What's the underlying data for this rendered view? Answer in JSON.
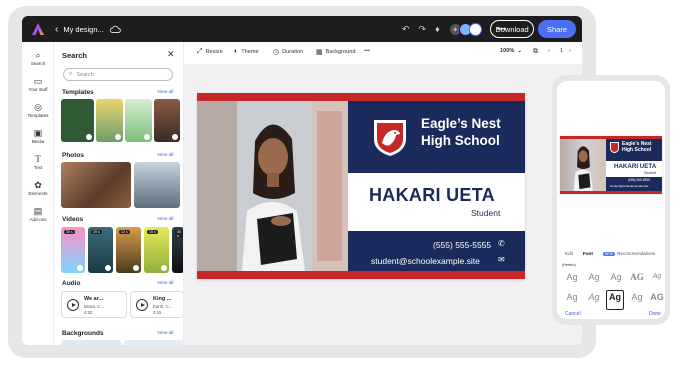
{
  "topbar": {
    "doc_title": "My design...",
    "download_label": "Download",
    "share_label": "Share",
    "accent": "#4b6ef5"
  },
  "rail": [
    {
      "icon": "search-icon",
      "label": "Search"
    },
    {
      "icon": "folder-icon",
      "label": "Your stuff"
    },
    {
      "icon": "templates-icon",
      "label": "Templates"
    },
    {
      "icon": "media-icon",
      "label": "Media"
    },
    {
      "icon": "text-icon",
      "label": "Text"
    },
    {
      "icon": "elements-icon",
      "label": "Elements"
    },
    {
      "icon": "addons-icon",
      "label": "Add-ons"
    }
  ],
  "panel": {
    "title": "Search",
    "search_placeholder": "Search",
    "view_all": "View all",
    "sections": {
      "templates": "Templates",
      "photos": "Photos",
      "videos": "Videos",
      "audio": "Audio",
      "backgrounds": "Backgrounds"
    },
    "video_badges": [
      "30 s",
      "19 s",
      "12 s",
      "15 s",
      "30 s"
    ],
    "audio": [
      {
        "title": "We ar...",
        "artist": "Brass, C...",
        "duration": "4:20"
      },
      {
        "title": "King ...",
        "artist": "Earth, C...",
        "duration": "2:15"
      }
    ]
  },
  "toolbar": {
    "resize": "Resize",
    "theme": "Theme",
    "duration": "Duration",
    "background": "Background",
    "zoom": "100%",
    "page_num": "1"
  },
  "card": {
    "school_line1": "Eagle’s Nest",
    "school_line2": "High School",
    "name": "HAKARI UETA",
    "role": "Student",
    "phone": "(555) 555-5555",
    "email": "student@schoolexample.site",
    "navy": "#1b2a5c",
    "red": "#c62828"
  },
  "mobile": {
    "school_line1": "Eagle’s Nest",
    "school_line2": "High School",
    "name": "HAKARI UETA",
    "role": "Student",
    "phone": "(555) 555-5555",
    "email": "student@schoolexample.site",
    "tabs": {
      "edit": "Edit",
      "font": "Font",
      "new": "NEW",
      "rec": "Recommendations"
    },
    "font_label": "(Heebo)",
    "cancel": "Cancel",
    "done": "Done"
  }
}
